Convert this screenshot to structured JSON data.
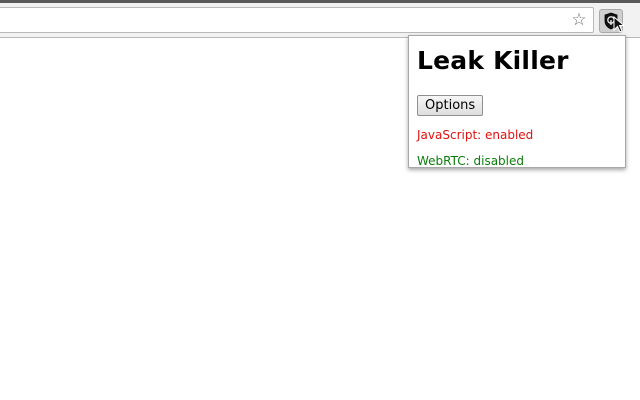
{
  "toolbar": {
    "bookmark_icon": "star-icon",
    "extension_icon": "leak-killer-shield-icon"
  },
  "popup": {
    "title": "Leak Killer",
    "options_label": "Options",
    "javascript_status": "JavaScript: enabled",
    "webrtc_status": "WebRTC: disabled"
  },
  "colors": {
    "enabled": "#e01010",
    "disabled": "#0b7d0b"
  }
}
